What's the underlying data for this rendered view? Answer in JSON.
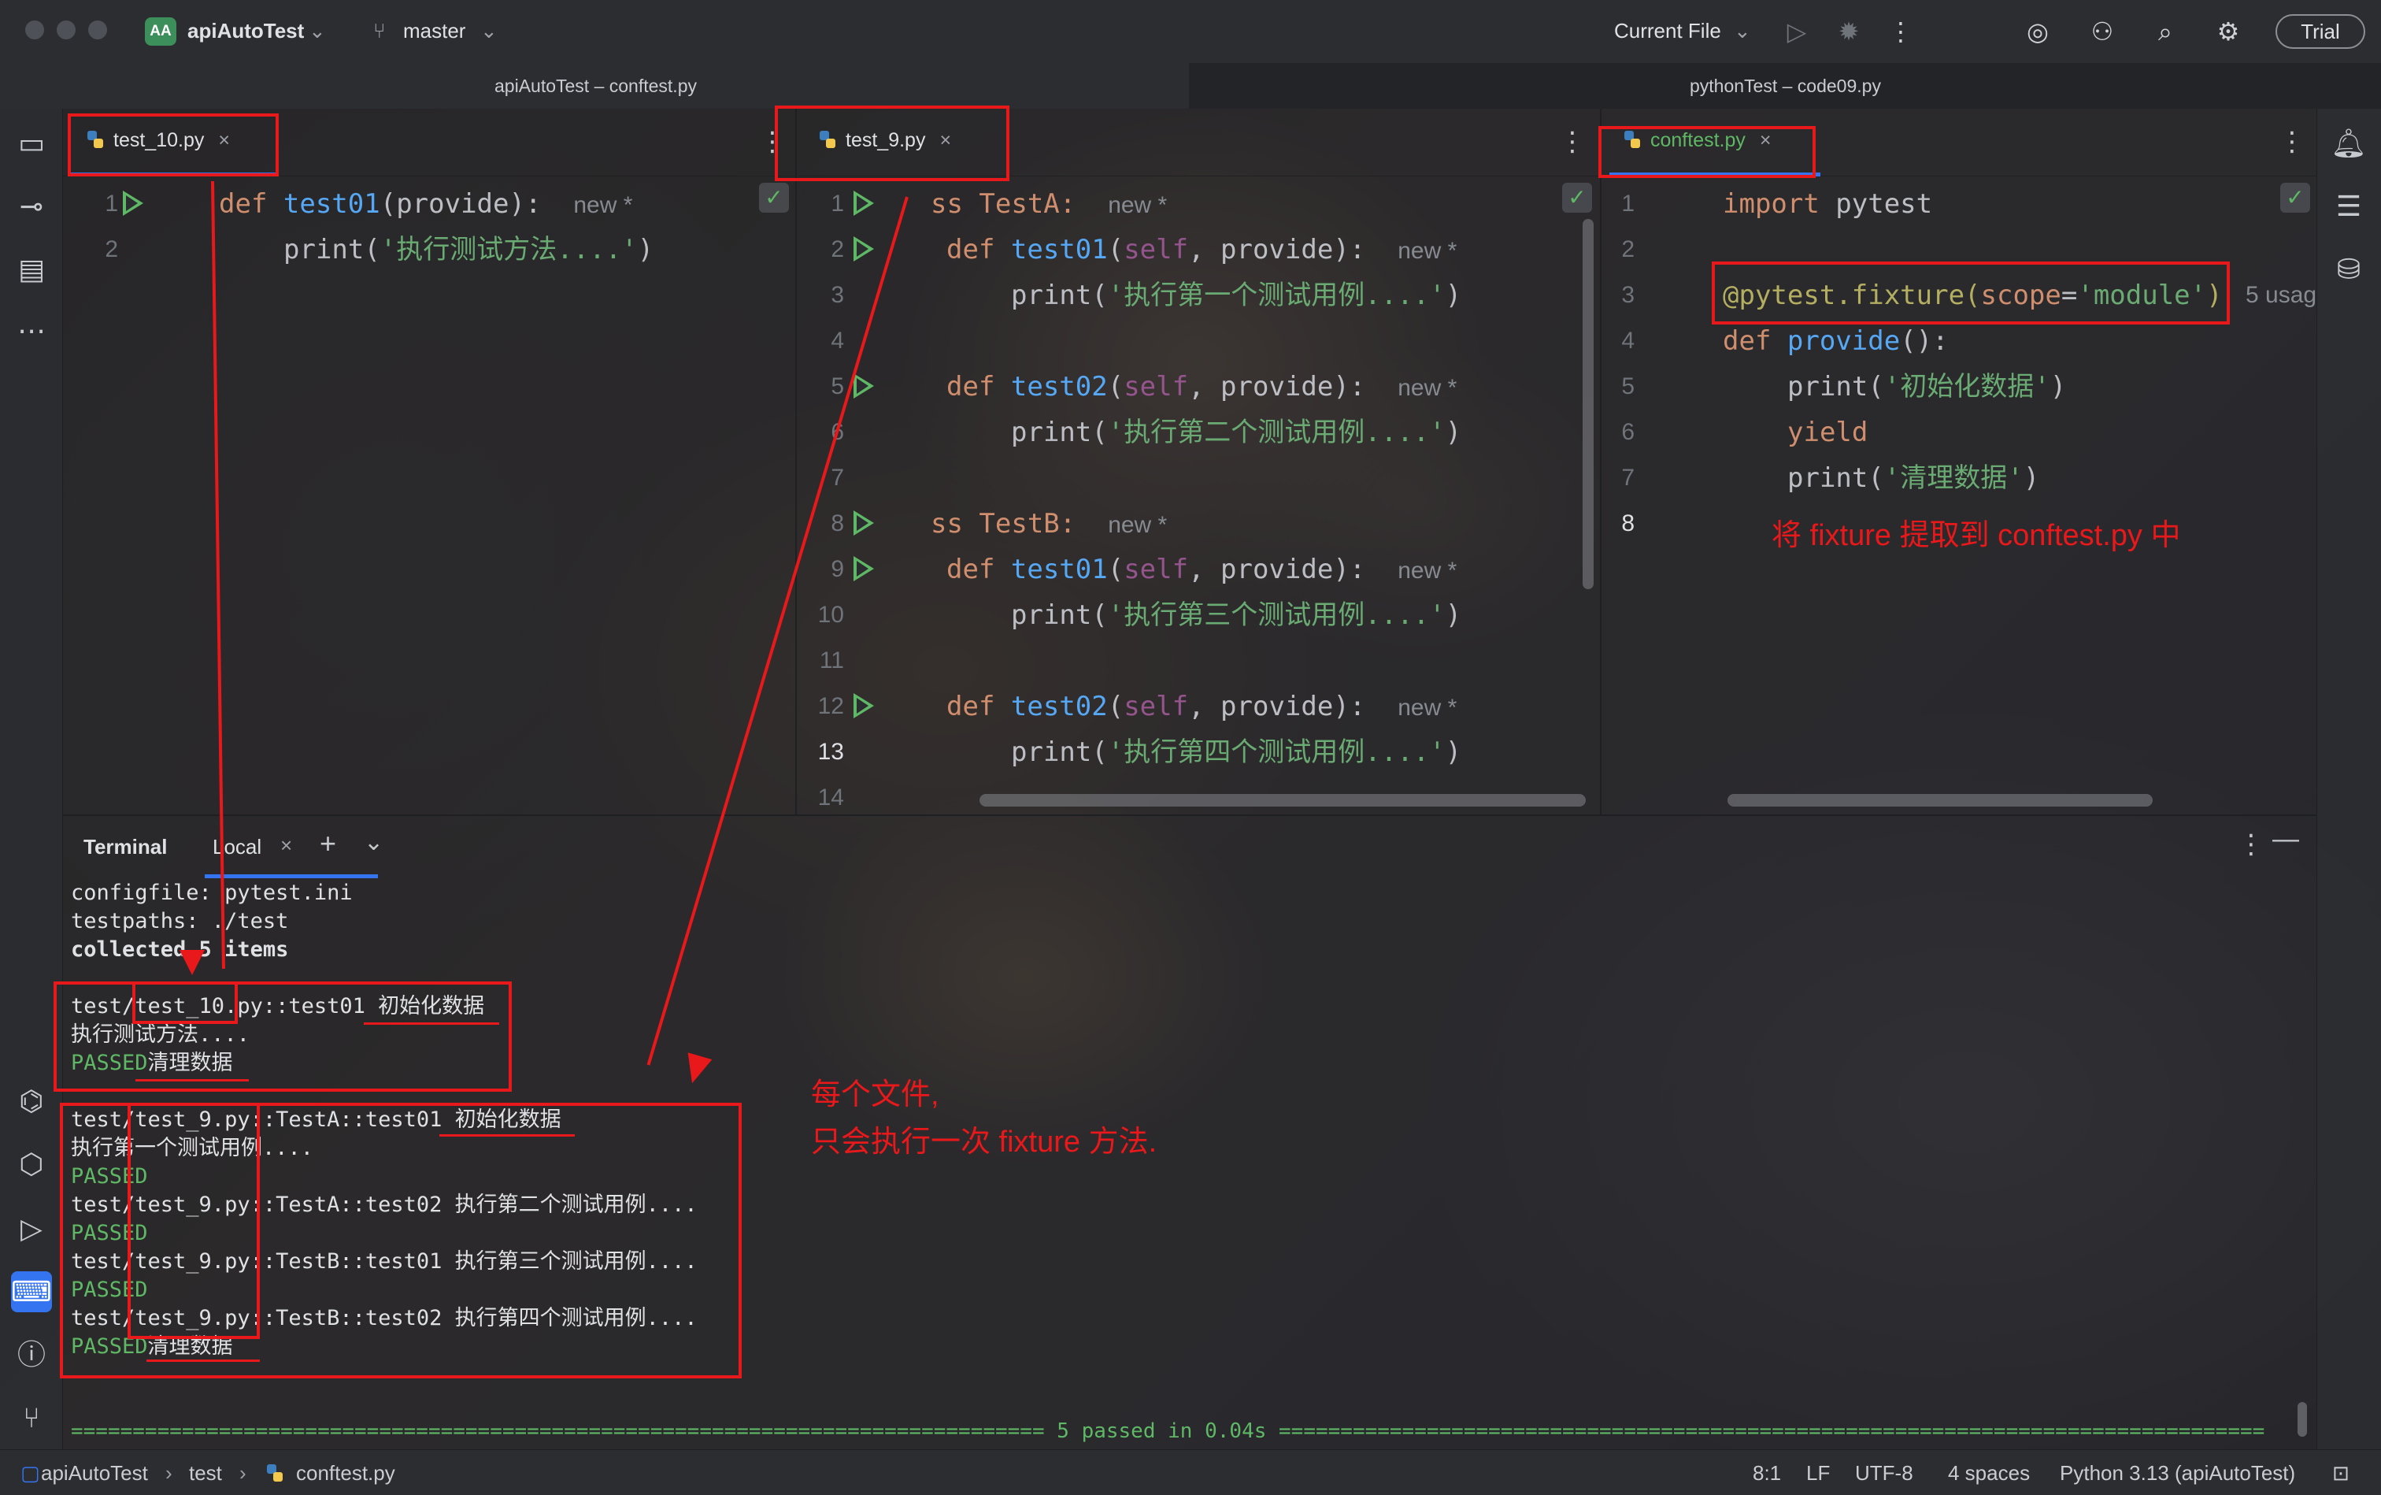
{
  "app": {
    "project": "apiAutoTest",
    "project_badge": "AA",
    "branch": "master",
    "run_config": "Current File",
    "trial": "Trial"
  },
  "windows": {
    "left_title": "apiAutoTest – conftest.py",
    "right_title": "pythonTest – code09.py"
  },
  "editor1": {
    "tab": "test_10.py",
    "line_numbers": [
      "1",
      "2"
    ],
    "hint": "new *",
    "code": {
      "l1_def": "def ",
      "l1_fn": "test01",
      "l1_rest": "(provide):",
      "l2_print": "print(",
      "l2_str": "'执行测试方法....'",
      "l2_close": ")"
    }
  },
  "editor2": {
    "tab": "test_9.py",
    "hint": "new *",
    "line_numbers": [
      "1",
      "2",
      "3",
      "4",
      "5",
      "6",
      "7",
      "8",
      "9",
      "10",
      "11",
      "12",
      "13",
      "14"
    ],
    "lines": {
      "class_a": "ss TestA:",
      "class_b": "ss TestB:",
      "def": "def ",
      "t1": "test01",
      "t2": "test02",
      "paren": "(",
      "self": "self",
      "args": ", provide):",
      "print": "print(",
      "close": ")",
      "s1": "'执行第一个测试用例....'",
      "s2": "'执行第二个测试用例....'",
      "s3": "'执行第三个测试用例....'",
      "s4": "'执行第四个测试用例....'"
    }
  },
  "editor3": {
    "tab": "conftest.py",
    "line_numbers": [
      "1",
      "2",
      "3",
      "4",
      "5",
      "6",
      "7",
      "8"
    ],
    "usages_hint": "5 usag",
    "lines": {
      "import_kw": "import ",
      "import_mod": "pytest",
      "dec": "@pytest.fixture(",
      "scope_kw": "scope",
      "eq": "=",
      "scope_val": "'module'",
      "dec_close": ")",
      "def_kw": "def ",
      "def_fn": "provide",
      "def_rest": "():",
      "print": "print(",
      "s_init": "'初始化数据'",
      "yield": "yield",
      "s_clean": "'清理数据'",
      "close": ")"
    }
  },
  "terminal": {
    "title": "Terminal",
    "tab": "Local",
    "lines": [
      "configfile: pytest.ini",
      "testpaths: ./test",
      "collected 5 items",
      "test/test_10.py::test01 初始化数据",
      "执行测试方法....",
      "清理数据",
      "test/test_9.py::TestA::test01 初始化数据",
      "执行第一个测试用例....",
      "test/test_9.py::TestA::test02 执行第二个测试用例....",
      "test/test_9.py::TestB::test01 执行第三个测试用例....",
      "test/test_9.py::TestB::test02 执行第四个测试用例....",
      "清理数据"
    ],
    "passed": "PASSED",
    "summary": "=============================================================================== 5 passed in 0.04s ================================================================================"
  },
  "annotations": {
    "fixture_note": "将 fixture 提取到 conftest.py 中",
    "file_note_1": "每个文件,",
    "file_note_2": "只会执行一次 fixture 方法."
  },
  "status": {
    "crumb_project": "apiAutoTest",
    "crumb_folder": "test",
    "crumb_file": "conftest.py",
    "position": "8:1",
    "line_sep": "LF",
    "encoding": "UTF-8",
    "indent": "4 spaces",
    "interpreter": "Python 3.13 (apiAutoTest)"
  },
  "colors": {
    "accent": "#3574f0",
    "annotation_red": "#e8181b",
    "passed_green": "#5fb865"
  }
}
